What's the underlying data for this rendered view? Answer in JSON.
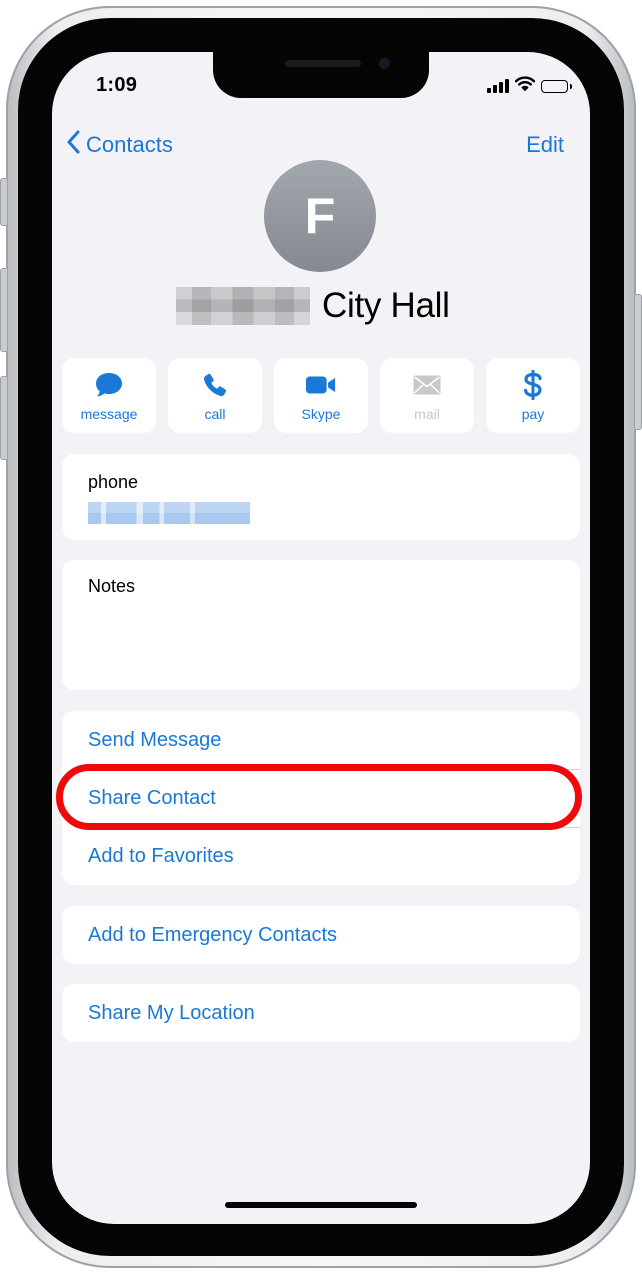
{
  "status_bar": {
    "time": "1:09",
    "icons": [
      "signal-bars-icon",
      "wifi-icon",
      "battery-icon"
    ]
  },
  "nav": {
    "back_label": "Contacts",
    "edit_label": "Edit"
  },
  "contact": {
    "avatar_initial": "F",
    "name_visible": "City Hall"
  },
  "actions": [
    {
      "label": "message",
      "icon": "message-bubble-icon",
      "enabled": true
    },
    {
      "label": "call",
      "icon": "phone-icon",
      "enabled": true
    },
    {
      "label": "Skype",
      "icon": "video-camera-icon",
      "enabled": true
    },
    {
      "label": "mail",
      "icon": "envelope-icon",
      "enabled": false
    },
    {
      "label": "pay",
      "icon": "dollar-icon",
      "enabled": true
    }
  ],
  "phone_card": {
    "label": "phone"
  },
  "notes_card": {
    "label": "Notes"
  },
  "action_list": [
    "Send Message",
    "Share Contact",
    "Add to Favorites"
  ],
  "emergency_label": "Add to Emergency Contacts",
  "location_label": "Share My Location",
  "colors": {
    "accent": "#1a78d6",
    "background": "#f2f2f7",
    "highlight": "#ef0a0a",
    "disabled": "#c7c7cc"
  }
}
